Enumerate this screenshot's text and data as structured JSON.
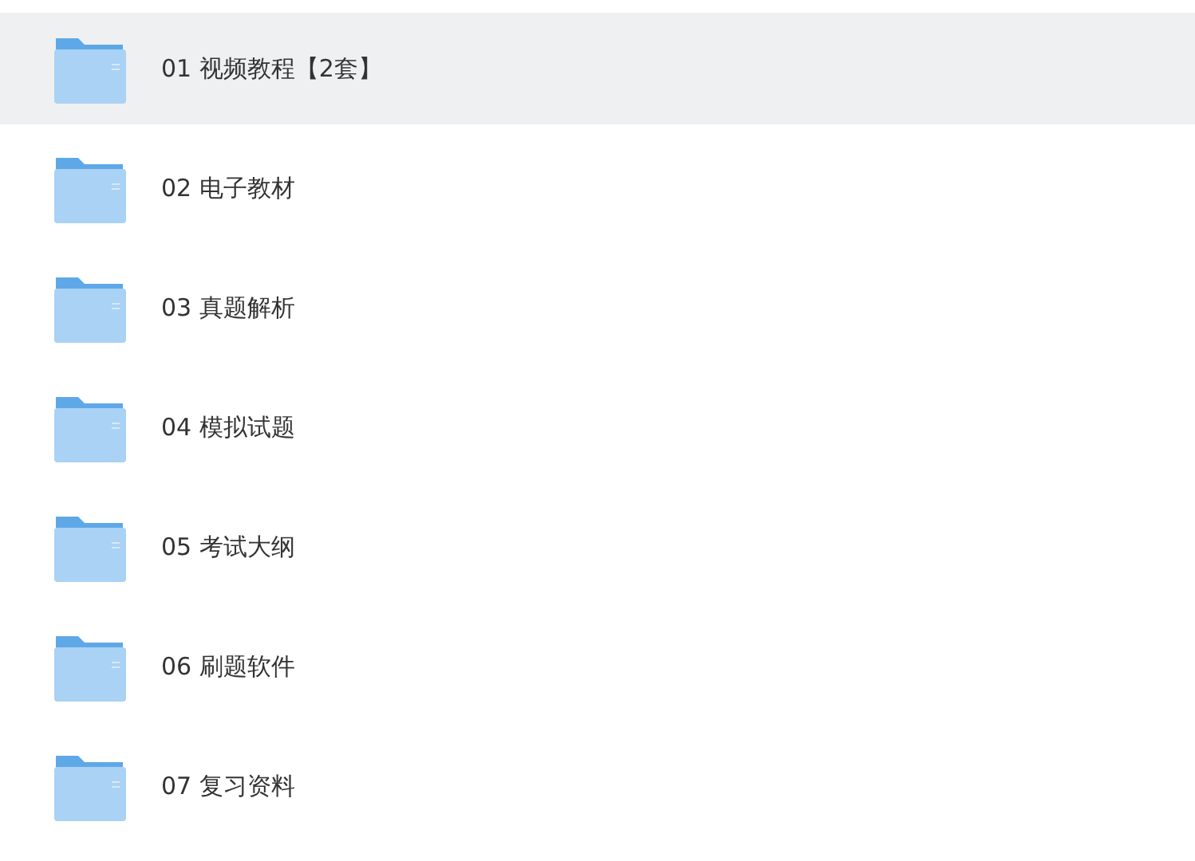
{
  "folders": [
    {
      "name": "01 视频教程【2套】",
      "selected": true
    },
    {
      "name": "02 电子教材",
      "selected": false
    },
    {
      "name": "03 真题解析",
      "selected": false
    },
    {
      "name": "04 模拟试题",
      "selected": false
    },
    {
      "name": "05 考试大纲",
      "selected": false
    },
    {
      "name": "06 刷题软件",
      "selected": false
    },
    {
      "name": "07 复习资料",
      "selected": false
    }
  ]
}
